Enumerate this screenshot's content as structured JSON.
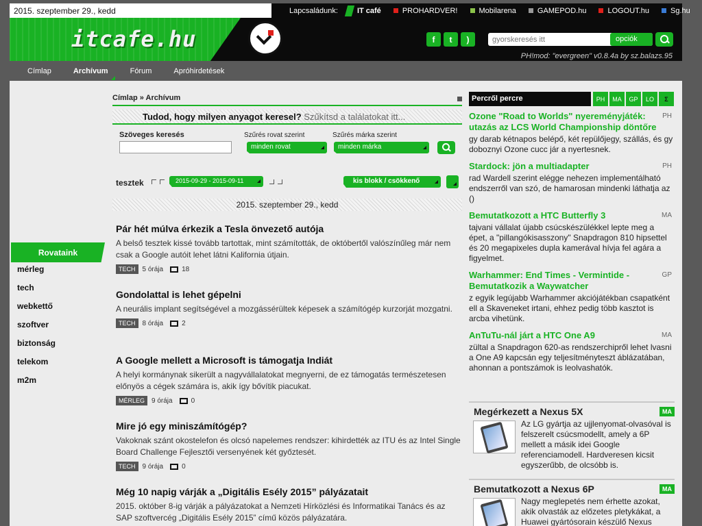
{
  "header": {
    "date": "2015. szeptember 29., kedd",
    "logo_text": "itcafe.hu",
    "family_label": "Lapcsaládunk:",
    "family_sites": [
      {
        "label": "IT café",
        "color": "#19b224"
      },
      {
        "label": "PROHARDVER!",
        "color": "#e0201b"
      },
      {
        "label": "Mobilarena",
        "color": "#8bc34a"
      },
      {
        "label": "GAMEPOD.hu",
        "color": "#999999"
      },
      {
        "label": "LOGOUT.hu",
        "color": "#e0201b"
      },
      {
        "label": "Sg.hu",
        "color": "#3a7bd5"
      }
    ],
    "social_icons": [
      "facebook-icon",
      "twitter-icon",
      "rss-icon"
    ],
    "search_placeholder": "gyorskeresés itt",
    "search_options_label": "opciók",
    "signature": "PH!mod: \"evergreen\" v0.8.4a by sz.balazs.95"
  },
  "nav": {
    "items": [
      "Címlap",
      "Archívum",
      "Fórum",
      "Apróhirdetések"
    ],
    "active": "Archívum"
  },
  "sidebar": {
    "heading": "Rovataink",
    "items": [
      "mérleg",
      "tech",
      "webkettő",
      "szoftver",
      "biztonság",
      "telekom",
      "m2m"
    ]
  },
  "breadcrumb": {
    "home": "Címlap",
    "separator": "»",
    "current": "Archívum"
  },
  "search_hint": {
    "bold": "Tudod, hogy milyen anyagot keresel?",
    "rest": "Szűkítsd a találatokat itt..."
  },
  "filters": {
    "text_label": "Szöveges keresés",
    "text_value": "",
    "rovat_label": "Szűrés rovat szerint",
    "rovat_value": "minden rovat",
    "marka_label": "Szűrés márka szerint",
    "marka_value": "minden márka"
  },
  "listing": {
    "label": "tesztek",
    "date_range": "2015-09-29 - 2015-09-11",
    "size_toggle_a": "kis blokk",
    "size_toggle_sep": " / ",
    "size_toggle_b": "csökkenő",
    "day_header": "2015. szeptember 29., kedd"
  },
  "articles": [
    {
      "title": "Pár hét múlva érkezik a Tesla önvezető autója",
      "lead": "A belső tesztek kissé tovább tartottak, mint számították, de októbertől valószínűleg már nem csak a Google autóit lehet látni Kalifornia útjain.",
      "tag": "TECH",
      "age": "5 órája",
      "comments": "18"
    },
    {
      "title": "Gondolattal is lehet gépelni",
      "lead": "A neurális implant segítségével a mozgássérültek képesek a számítógép kurzorját mozgatni.",
      "tag": "TECH",
      "age": "8 órája",
      "comments": "2"
    },
    {
      "title": "A Google mellett a Microsoft is támogatja Indiát",
      "lead": "A helyi kormánynak sikerült a nagyvállalatokat megnyerni, de ez támogatás természetesen előnyös a cégek számára is, akik így bővítik piacukat.",
      "tag": "MÉRLEG",
      "age": "9 órája",
      "comments": "0"
    },
    {
      "title": "Mire jó egy miniszámítógép?",
      "lead": "Vakoknak szánt okostelefon és olcsó napelemes rendszer: kihirdették az ITU és az Intel Single Board Challenge Fejlesztői versenyének két győztesét.",
      "tag": "TECH",
      "age": "9 órája",
      "comments": "0"
    },
    {
      "title": "Még 10 napig várják a „Digitális Esély 2015” pályázatait",
      "lead": "2015. október 8-ig várják a pályázatokat a Nemzeti Hírközlési és Informatikai Tanács és az SAP szoftvercég „Digitális Esély 2015” című közös pályázatára.",
      "tag": "",
      "age": "",
      "comments": ""
    }
  ],
  "percrol": {
    "title": "Percről percre",
    "tabs": [
      "PH",
      "MA",
      "GP",
      "LO",
      "Σ"
    ],
    "items": [
      {
        "title": "Ozone \"Road to Worlds\" nyereményjáték: utazás az LCS World Championship döntőre",
        "site": "PH",
        "text": "gy darab kétnapos belépő, két repülőjegy, szállás, és gy doboznyi Ozone cucc jár a nyertesnek."
      },
      {
        "title": "Stardock: jön a multiadapter",
        "site": "PH",
        "text": "rad Wardell szerint elégge nehezen implementálható endszerről van szó, de hamarosan mindenki láthatja az ()"
      },
      {
        "title": "Bemutatkozott a HTC Butterfly 3",
        "site": "MA",
        "text": "tajvani vállalat újabb csúcskészülékkel lepte meg a épet, a \"pillangókisasszony\" Snapdragon 810 hipsettel és 20 megapixeles dupla kamerával hívja fel agára a figyelmet."
      },
      {
        "title": "Warhammer: End Times - Vermintide - Bemutatkozik a Waywatcher",
        "site": "GP",
        "text": "z egyik legújabb Warhammer akciójátékban csapatként ell a Skaveneket irtani, ehhez pedig több kasztot is arcba vihetünk."
      },
      {
        "title": "AnTuTu-nál járt a HTC One A9",
        "site": "MA",
        "text": "zültal a Snapdragon 620-as rendszerchipről lehet lvasni a One A9 kapcsán egy teljesítményteszt áblázatában, ahonnan a pontszámok is leolvashatók."
      }
    ]
  },
  "cards": [
    {
      "title": "Megérkezett a Nexus 5X",
      "badge": "MA",
      "text": "Az LG gyártja az ujjlenyomat-olvasóval is felszerelt csúcsmodellt, amely a 6P mellett a másik idei Google referenciamodell. Hardveresen kicsit egyszerűbb, de olcsóbb is."
    },
    {
      "title": "Bemutatkozott a Nexus 6P",
      "badge": "MA",
      "text": "Nagy meglepetés nem érhette azokat, akik olvasták az előzetes pletykákat, a Huawei gyártósorain készülő Nexus"
    }
  ]
}
